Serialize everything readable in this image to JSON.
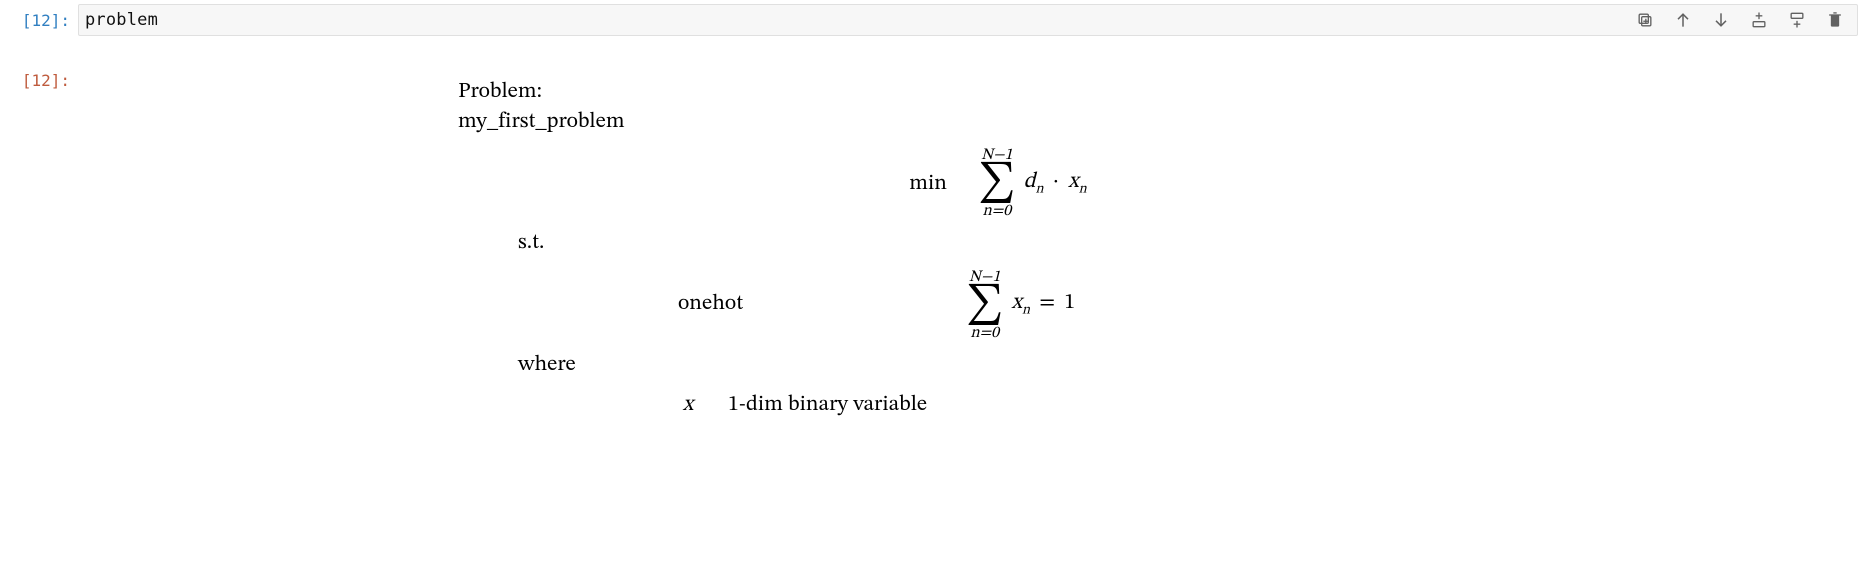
{
  "input": {
    "prompt_number": "[12]:",
    "code": "problem"
  },
  "output": {
    "prompt_number": "[12]:"
  },
  "toolbar_icons": {
    "duplicate": "duplicate-cell-icon",
    "up": "move-up-icon",
    "down": "move-down-icon",
    "insert_above": "insert-above-icon",
    "insert_below": "insert-below-icon",
    "delete": "delete-icon"
  },
  "problem": {
    "heading_label": "Problem:",
    "name": "my_first_problem",
    "objective": {
      "prefix": "min",
      "sum_lower": "n=0",
      "sum_upper": "N−1",
      "term_d": "d",
      "term_d_sub": "n",
      "dot": "·",
      "term_x": "x",
      "term_x_sub": "n"
    },
    "st_label": "s.t.",
    "constraint": {
      "name": "onehot",
      "sum_lower": "n=0",
      "sum_upper": "N−1",
      "term_x": "x",
      "term_x_sub": "n",
      "eq": "=",
      "rhs": "1"
    },
    "where_label": "where",
    "variable": {
      "symbol": "x",
      "description": "1-dim binary variable"
    }
  }
}
